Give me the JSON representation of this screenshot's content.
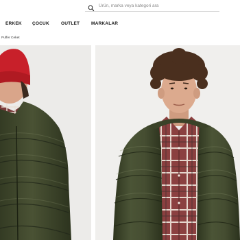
{
  "search": {
    "placeholder": "Ürün, marka veya kategori ara",
    "icon": "search-icon"
  },
  "nav": {
    "items": [
      "ERKEK",
      "ÇOCUK",
      "OUTLET",
      "MARKALAR"
    ]
  },
  "breadcrumb": {
    "current": "Puffer Ceket"
  },
  "products": {
    "left_image": "model-red-beanie-green-puffer",
    "right_image": "model-curly-hair-green-puffer",
    "colors": {
      "jacket": "#3d4429",
      "beanie": "#c8202a"
    }
  }
}
